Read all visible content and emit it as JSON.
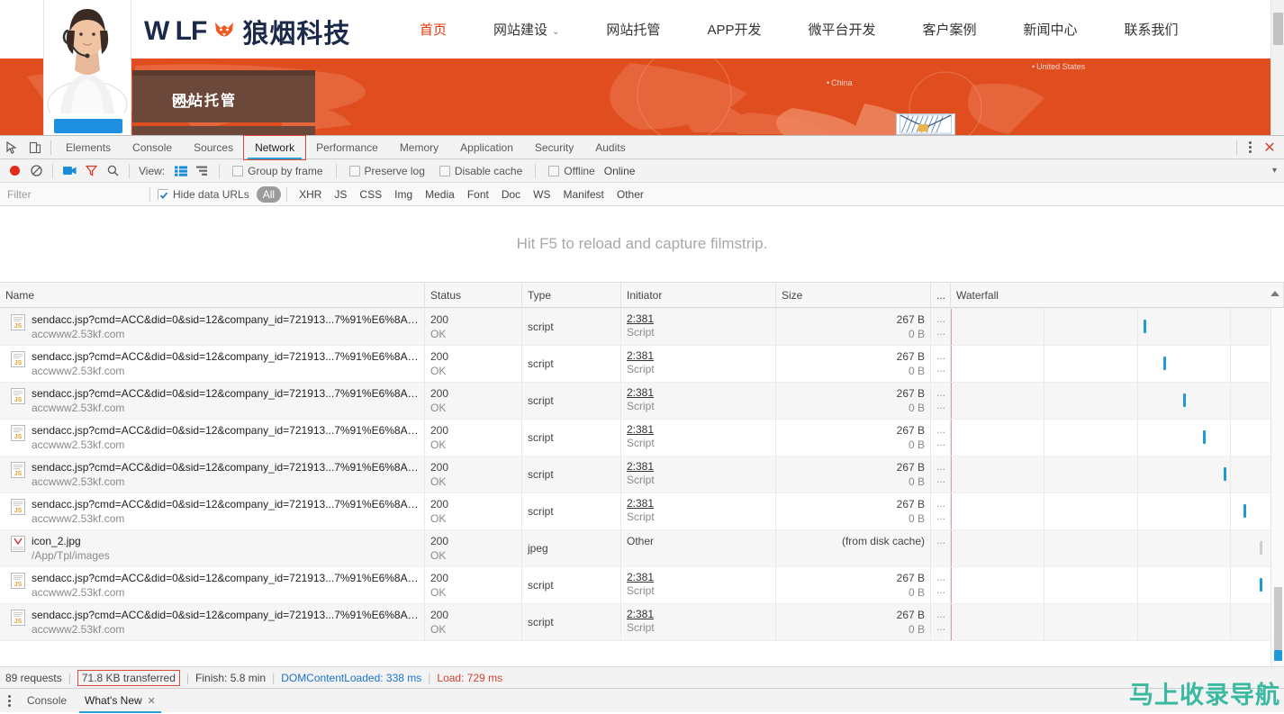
{
  "site": {
    "logo_text_en": "W LF",
    "logo_text_cn": "狼烟科技",
    "nav": [
      {
        "label": "首页",
        "active": true,
        "caret": false
      },
      {
        "label": "网站建设",
        "active": false,
        "caret": true
      },
      {
        "label": "网站托管",
        "active": false,
        "caret": false
      },
      {
        "label": "APP开发",
        "active": false,
        "caret": false
      },
      {
        "label": "微平台开发",
        "active": false,
        "caret": false
      },
      {
        "label": "客户案例",
        "active": false,
        "caret": false
      },
      {
        "label": "新闻中心",
        "active": false,
        "caret": false
      },
      {
        "label": "联系我们",
        "active": false,
        "caret": false
      }
    ],
    "banner": {
      "card_label": "网站托管",
      "map_labels": [
        "China",
        "United States"
      ],
      "bg_color": "#e04e20"
    }
  },
  "devtools": {
    "tabs": [
      {
        "label": "Elements",
        "active": false,
        "boxed": false
      },
      {
        "label": "Console",
        "active": false,
        "boxed": false
      },
      {
        "label": "Sources",
        "active": false,
        "boxed": false
      },
      {
        "label": "Network",
        "active": true,
        "boxed": true
      },
      {
        "label": "Performance",
        "active": false,
        "boxed": false
      },
      {
        "label": "Memory",
        "active": false,
        "boxed": false
      },
      {
        "label": "Application",
        "active": false,
        "boxed": false
      },
      {
        "label": "Security",
        "active": false,
        "boxed": false
      },
      {
        "label": "Audits",
        "active": false,
        "boxed": false
      }
    ],
    "toolbar": {
      "view_label": "View:",
      "group_by_frame": "Group by frame",
      "preserve_log": "Preserve log",
      "disable_cache": "Disable cache",
      "offline": "Offline",
      "online": "Online"
    },
    "filter": {
      "placeholder": "Filter",
      "value": "",
      "hide_data_urls": "Hide data URLs",
      "types": [
        "All",
        "XHR",
        "JS",
        "CSS",
        "Img",
        "Media",
        "Font",
        "Doc",
        "WS",
        "Manifest",
        "Other"
      ],
      "selected_type": "All"
    },
    "filmstrip_hint": "Hit F5 to reload and capture filmstrip.",
    "columns": [
      "Name",
      "Status",
      "Type",
      "Initiator",
      "Size",
      "...",
      "Waterfall"
    ],
    "requests": [
      {
        "name": "sendacc.jsp?cmd=ACC&did=0&sid=12&company_id=721913...7%91%E6%8A%...",
        "domain": "accwww2.53kf.com",
        "status": "200",
        "status_text": "OK",
        "type": "script",
        "initiator": "2:381",
        "initiator_sub": "Script",
        "size": "267 B",
        "size_sub": "0 B",
        "extra": "...",
        "wf": 47,
        "clipped": true
      },
      {
        "name": "sendacc.jsp?cmd=ACC&did=0&sid=12&company_id=721913...7%91%E6%8A%...",
        "domain": "accwww2.53kf.com",
        "status": "200",
        "status_text": "OK",
        "type": "script",
        "initiator": "2:381",
        "initiator_sub": "Script",
        "size": "267 B",
        "size_sub": "0 B",
        "extra": "...",
        "wf": 58,
        "clipped": false
      },
      {
        "name": "sendacc.jsp?cmd=ACC&did=0&sid=12&company_id=721913...7%91%E6%8A%...",
        "domain": "accwww2.53kf.com",
        "status": "200",
        "status_text": "OK",
        "type": "script",
        "initiator": "2:381",
        "initiator_sub": "Script",
        "size": "267 B",
        "size_sub": "0 B",
        "extra": "...",
        "wf": 64,
        "clipped": false
      },
      {
        "name": "sendacc.jsp?cmd=ACC&did=0&sid=12&company_id=721913...7%91%E6%8A%...",
        "domain": "accwww2.53kf.com",
        "status": "200",
        "status_text": "OK",
        "type": "script",
        "initiator": "2:381",
        "initiator_sub": "Script",
        "size": "267 B",
        "size_sub": "0 B",
        "extra": "...",
        "wf": 70,
        "clipped": false
      },
      {
        "name": "sendacc.jsp?cmd=ACC&did=0&sid=12&company_id=721913...7%91%E6%8A%...",
        "domain": "accwww2.53kf.com",
        "status": "200",
        "status_text": "OK",
        "type": "script",
        "initiator": "2:381",
        "initiator_sub": "Script",
        "size": "267 B",
        "size_sub": "0 B",
        "extra": "...",
        "wf": 76,
        "clipped": false
      },
      {
        "name": "sendacc.jsp?cmd=ACC&did=0&sid=12&company_id=721913...7%91%E6%8A%...",
        "domain": "accwww2.53kf.com",
        "status": "200",
        "status_text": "OK",
        "type": "script",
        "initiator": "2:381",
        "initiator_sub": "Script",
        "size": "267 B",
        "size_sub": "0 B",
        "extra": "...",
        "wf": 82,
        "clipped": false
      },
      {
        "name": "sendacc.jsp?cmd=ACC&did=0&sid=12&company_id=721913...7%91%E6%8A%...",
        "domain": "accwww2.53kf.com",
        "status": "200",
        "status_text": "OK",
        "type": "script",
        "initiator": "2:381",
        "initiator_sub": "Script",
        "size": "267 B",
        "size_sub": "0 B",
        "extra": "...",
        "wf": 88,
        "clipped": false
      },
      {
        "name": "icon_2.jpg",
        "domain": "/App/Tpl/images",
        "status": "200",
        "status_text": "OK",
        "type": "jpeg",
        "initiator": "Other",
        "initiator_sub": "",
        "size": "(from disk cache)",
        "size_sub": "",
        "extra": "...",
        "wf": 93,
        "clipped": false,
        "faint": true
      },
      {
        "name": "sendacc.jsp?cmd=ACC&did=0&sid=12&company_id=721913...7%91%E6%8A%...",
        "domain": "accwww2.53kf.com",
        "status": "200",
        "status_text": "OK",
        "type": "script",
        "initiator": "2:381",
        "initiator_sub": "Script",
        "size": "267 B",
        "size_sub": "0 B",
        "extra": "...",
        "wf": 93,
        "clipped": false
      },
      {
        "name": "sendacc.jsp?cmd=ACC&did=0&sid=12&company_id=721913...7%91%E6%8A%...",
        "domain": "accwww2.53kf.com",
        "status": "200",
        "status_text": "OK",
        "type": "script",
        "initiator": "2:381",
        "initiator_sub": "Script",
        "size": "267 B",
        "size_sub": "0 B",
        "extra": "...",
        "wf": 99,
        "clipped": false
      }
    ],
    "summary": {
      "requests": "89 requests",
      "transferred": "71.8 KB transferred",
      "finish": "Finish: 5.8 min",
      "dom_content_loaded": "DOMContentLoaded: 338 ms",
      "load": "Load: 729 ms"
    },
    "drawer": {
      "tabs": [
        {
          "label": "Console",
          "active": false,
          "closable": false
        },
        {
          "label": "What's New",
          "active": true,
          "closable": true
        }
      ],
      "close_glyph": "✕"
    }
  },
  "watermark": {
    "text": "马上收录导航",
    "color": "#3bb9a0"
  }
}
